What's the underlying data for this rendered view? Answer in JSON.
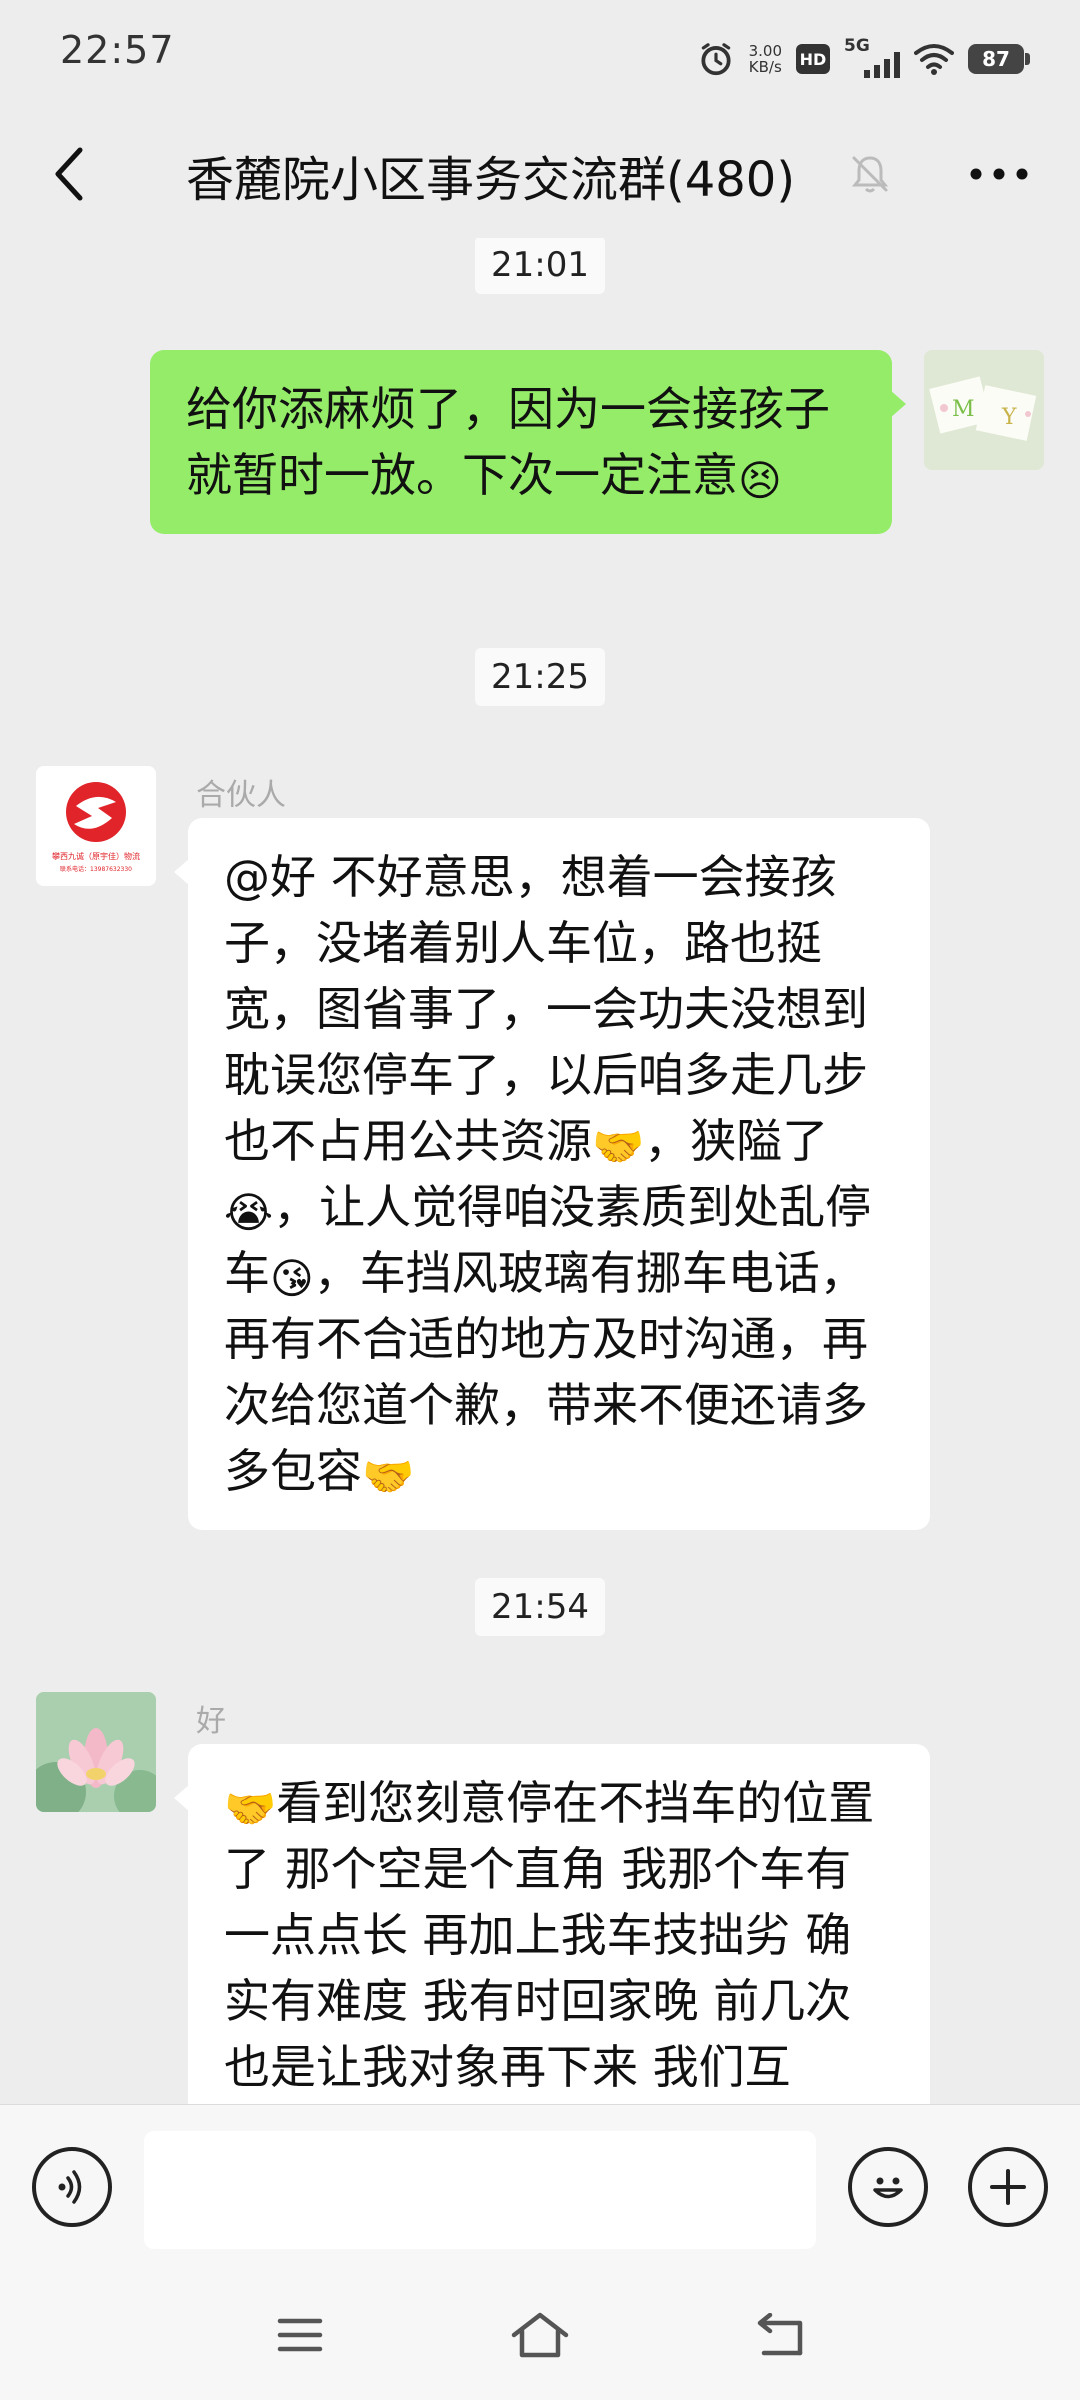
{
  "status_bar": {
    "time": "22:57",
    "net_speed_value": "3.00",
    "net_speed_unit": "KB/s",
    "hd_label": "HD",
    "network_label": "5G",
    "battery_level": "87"
  },
  "header": {
    "title": "香麓院小区事务交流群(480)",
    "icons": [
      "back-icon",
      "mute-bell-icon",
      "more-icon"
    ]
  },
  "messages": [
    {
      "type": "time",
      "text": "21:01"
    },
    {
      "type": "outgoing",
      "text": "给你添麻烦了，因为一会接孩子就暂时一放。下次一定注意",
      "trailing_emoji": "😣"
    },
    {
      "type": "time",
      "text": "21:25"
    },
    {
      "type": "incoming",
      "sender": "合伙人",
      "avatar_text": "攀西九诚（原宇佳）物流",
      "avatar_subtext": "联系电话：13987632330",
      "segments": [
        "@好  不好意思，想着一会接孩子，没堵着别人车位，路也挺宽，图省事了，一会功夫没想到耽误您停车了，以后咱多走几步也不占用公共资源",
        "🤝",
        "，狭隘了",
        "😭",
        "，让人觉得咱没素质到处乱停车",
        "😘",
        "，车挡风玻璃有挪车电话，再有不合适的地方及时沟通，再次给您道个歉，带来不便还请多多包容",
        "🤝"
      ]
    },
    {
      "type": "time",
      "text": "21:54"
    },
    {
      "type": "incoming",
      "sender": "好",
      "leading_emoji": "🤝",
      "text": "看到您刻意停在不挡车的位置了 那个空是个直角 我那个车有一点点长 再加上我车技拙劣 确实有难度 我有时回家晚 前几次也是让我对象再下来 我们互"
    }
  ],
  "input_bar": {
    "placeholder": "",
    "icons": [
      "voice-icon",
      "emoji-icon",
      "plus-icon"
    ]
  },
  "nav_bar": {
    "icons": [
      "menu-icon",
      "home-icon",
      "back-gesture-icon"
    ]
  },
  "colors": {
    "background": "#ededed",
    "outgoing_bubble": "#95ec69",
    "incoming_bubble": "#ffffff",
    "logo_red": "#e0242a"
  }
}
